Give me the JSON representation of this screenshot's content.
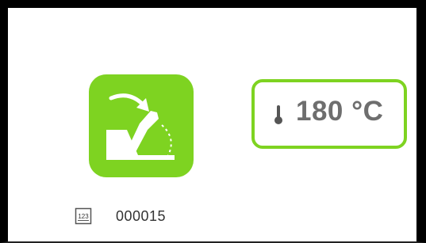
{
  "action_tile": {
    "icon": "tilt-pan-icon",
    "accent_color": "#7ed321"
  },
  "temperature": {
    "icon": "thermometer-icon",
    "value": "180",
    "unit": "°C",
    "display": "180 °C"
  },
  "counter": {
    "icon": "counter-123-icon",
    "value": "000015"
  }
}
